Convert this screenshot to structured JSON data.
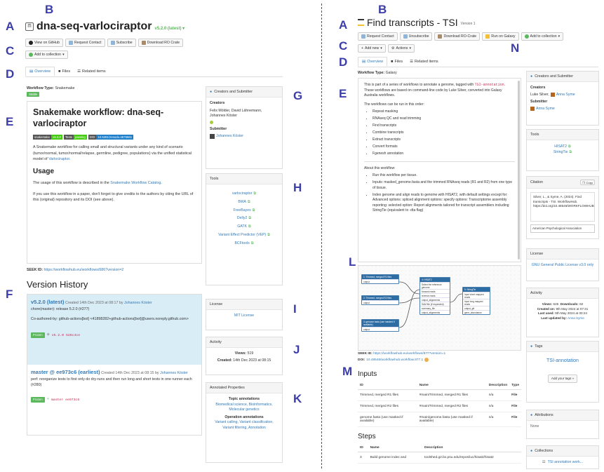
{
  "labels": {
    "A": "A",
    "B": "B",
    "C": "C",
    "D": "D",
    "E": "E",
    "F": "F",
    "G": "G",
    "H": "H",
    "I": "I",
    "J": "J",
    "K": "K",
    "L": "L",
    "M": "M",
    "N": "N"
  },
  "left": {
    "title": "dna-seq-varlociraptor",
    "version": "v5.2.0 (latest)",
    "buttons": {
      "github": "View on GitHub",
      "request": "Request Contact",
      "subscribe": "Subscribe",
      "download": "Download RO Crate",
      "add_collection": "Add to collection"
    },
    "tabs": {
      "overview": "Overview",
      "files": "Files",
      "related": "Related items"
    },
    "workflow_type_label": "Workflow Type:",
    "workflow_type": "Snakemake",
    "stable_badge": "Stable",
    "readme": {
      "heading": "Snakemake workflow: dna-seq-varlociraptor",
      "shields": {
        "snakemake_k": "snakemake",
        "snakemake_v": "≥6.3.0",
        "tests_k": "Tests",
        "tests_v": "passing",
        "doi_k": "DOI",
        "doi_v": "10.5281/zenodo.4675661"
      },
      "intro": "A Snakemake workflow for calling small and structural variants under any kind of scenario (tumor/normal, tumor/normal/relapse, germline, pedigree, populations) via the unified statistical model of",
      "intro_link": "Varlociraptor",
      "intro_end": ".",
      "usage_heading": "Usage",
      "usage_text": "The usage of this workflow is described in the",
      "usage_link": "Snakemake Workflow Catalog",
      "usage_end": ".",
      "cite_text": "If you use this workflow in a paper, don't forget to give credits to the authors by citing the URL of this (original) repository and its DOI (see above)."
    },
    "seek_id_label": "SEEK ID:",
    "seek_id": "https://workflowhub.eu/workflows/686?version=2",
    "version_history_heading": "Version History",
    "versions": [
      {
        "name": "v5.2.0 (latest)",
        "created": "Created 14th Dec 2023 at 08:17 by",
        "author": "Johannes Köster",
        "msg1": "chore(master): release 5.2.0 (#277)",
        "msg2": "Co-authored-by: github-actions[bot] <41898282+github-actions[bot]@users.noreply.github.com>",
        "frozen": "Frozen",
        "tag": "v5.2.0",
        "hash": "526c4ce"
      },
      {
        "name": "master @ ee973c6 (earliest)",
        "created": "Created 14th Dec 2023 at 08:15 by",
        "author": "Johannes Köster",
        "msg1": "perf: reorganize tests to first only do dry-runs and then run long and short tests in one runner each (#280)",
        "frozen": "Frozen",
        "branch": "master",
        "hash": "ee973c6"
      }
    ],
    "creators_panel": {
      "title": "Creators and Submitter",
      "creators_label": "Creators",
      "creators": "Felix Mölder, David Lähnemann, Johannes Köster",
      "submitter_label": "Submitter",
      "submitter": "Johannes Köster"
    },
    "tools_panel": {
      "title": "Tools",
      "items": [
        "varlociraptor",
        "BWA",
        "FreeBayes",
        "Delly2",
        "GATK",
        "Variant Effect Predictor (VEP)",
        "BCFtools"
      ]
    },
    "license_panel": {
      "title": "License",
      "value": "MIT License"
    },
    "activity_panel": {
      "title": "Activity",
      "views_label": "Views:",
      "views": "519",
      "created_label": "Created:",
      "created": "14th Dec 2023 at 08:15"
    },
    "annotated_panel": {
      "title": "Annotated Properties",
      "topic_label": "Topic annotations",
      "topic": "Biomedical science, Bioinformatics, Molecular genetics",
      "operation_label": "Operation annotations",
      "operation": "Variant calling, Variant classification, Variant filtering, Annotation"
    }
  },
  "right": {
    "title": "Find transcripts - TSI",
    "version": "Version 1",
    "buttons": {
      "request": "Request Contact",
      "unsubscribe": "Unsubscribe",
      "download": "Download RO-Crate",
      "galaxy": "Run on Galaxy",
      "add_collection": "Add to collection",
      "add_new": "Add new",
      "actions": "Actions"
    },
    "tabs": {
      "overview": "Overview",
      "files": "Files",
      "related": "Related items"
    },
    "workflow_type_label": "Workflow Type:",
    "workflow_type": "Galaxy",
    "desc": {
      "p1a": "This is part of a series of workflows to annotate a genome, tagged with",
      "p1tag": "TSI-annotation",
      "p1b": ". These workflows are based on command-line code by Luke Silver, converted into Galaxy Australia workflows.",
      "p2": "The workflows can be run in this order:",
      "order": [
        "Repeat masking",
        "RNAseq QC and read trimming",
        "Find transcripts",
        "Combine transcripts",
        "Extract transcripts",
        "Convert formats",
        "Fgenesh annotation"
      ],
      "about": "About this workflow:",
      "about_items": [
        "Run this workflow per tissue.",
        "Inputs: masked_genome.fasta and the trimmed RNAseq reads (R1 and R2) from one type of tissue.",
        "Index genome and align reads to genome with HISAT2, with default settings except for: Advanced options: spliced alignment options: specify options: Transcriptome assembly reporting: selected option: Report alignments tailored for transcript assemblers including StringTie (equivalent to -dta flag)"
      ]
    },
    "diagram": {
      "nodes": [
        {
          "title": "1: Trimmed, merged R1 files",
          "rows": [
            "output"
          ]
        },
        {
          "title": "2: Trimmed, merged R2 files",
          "rows": [
            "output"
          ]
        },
        {
          "title": "3: genome.fasta (use masked if available)",
          "rows": [
            "output"
          ]
        },
        {
          "title": "4: HISAT2",
          "rows": [
            "Select the reference genome",
            "forward reads",
            "reverse reads",
            "output_alignments",
            "SAM file (if requested)",
            "summary_file",
            "output_alignments"
          ]
        },
        {
          "title": "5: StringTie",
          "rows": [
            "Input short mapped reads",
            "Input long mapped reads",
            "output_gtf",
            "gene_abundance"
          ]
        }
      ]
    },
    "seek_id_label": "SEEK ID:",
    "seek_id": "https://workflowhub.eu/workflows/877?version=1",
    "doi_label": "DOI:",
    "doi": "10.48546/workflowhub.workflow.877.1",
    "inputs_heading": "Inputs",
    "inputs_cols": [
      "ID",
      "Name",
      "Description",
      "Type"
    ],
    "inputs_rows": [
      [
        "Trimmed, merged R1 files",
        "#main/Trimmed, merged R1 files",
        "n/a",
        "File"
      ],
      [
        "Trimmed, merged R2 files",
        "#main/Trimmed, merged R2 files",
        "n/a",
        "File"
      ],
      [
        "genome.fasta (use masked if available)",
        "#main/genome.fasta (use masked if available)",
        "n/a",
        "File"
      ]
    ],
    "steps_heading": "Steps",
    "steps_cols": [
      "ID",
      "Name",
      "Description"
    ],
    "steps_rows": [
      [
        "3",
        "Build genome index and",
        "toolshed.g2.bx.psu.edu/repos/iuc/hisat2/hisat2"
      ]
    ],
    "creators_panel": {
      "title": "Creators and Submitter",
      "creators_label": "Creators",
      "creator1": "Luke Silver,",
      "creator2": "Anna Syme",
      "submitter_label": "Submitter",
      "submitter": "Anna Syme"
    },
    "tools_panel": {
      "title": "Tools",
      "items": [
        "HISAT2",
        "StringTie"
      ]
    },
    "citation_panel": {
      "title": "Citation",
      "copy": "Copy",
      "text": "Silver, L., & Syme, A. (2024). Find transcripts - TSI. WorkflowHub. https://doi.org/10.48546/WORKFLOWHUB.WORKFLOW.8",
      "style": "American Psychological Association"
    },
    "license_panel": {
      "title": "License",
      "value": "GNU General Public License v3.0 only"
    },
    "activity_panel": {
      "title": "Activity",
      "views_label": "Views:",
      "views": "645",
      "downloads_label": "Downloads:",
      "downloads": "82",
      "created_label": "Created on:",
      "created": "9th May 2024 at 07:31",
      "used_label": "Last used:",
      "used": "9th May 2024 at 00:24",
      "updated_label": "Last updated by:",
      "updated": "Anna Syme"
    },
    "tags_panel": {
      "title": "Tags",
      "tag": "TSI-annotation",
      "add": "Add your tags »"
    },
    "attributions_panel": {
      "title": "Attributions",
      "value": "None"
    },
    "collections_panel": {
      "title": "Collections",
      "item": "TSI annotation work..."
    }
  },
  "colors": {
    "label": "#3b3ea8",
    "link": "#337ab7",
    "green": "#5cb85c",
    "highlight": "#d9edf7",
    "tag_red": "#c7254e"
  }
}
